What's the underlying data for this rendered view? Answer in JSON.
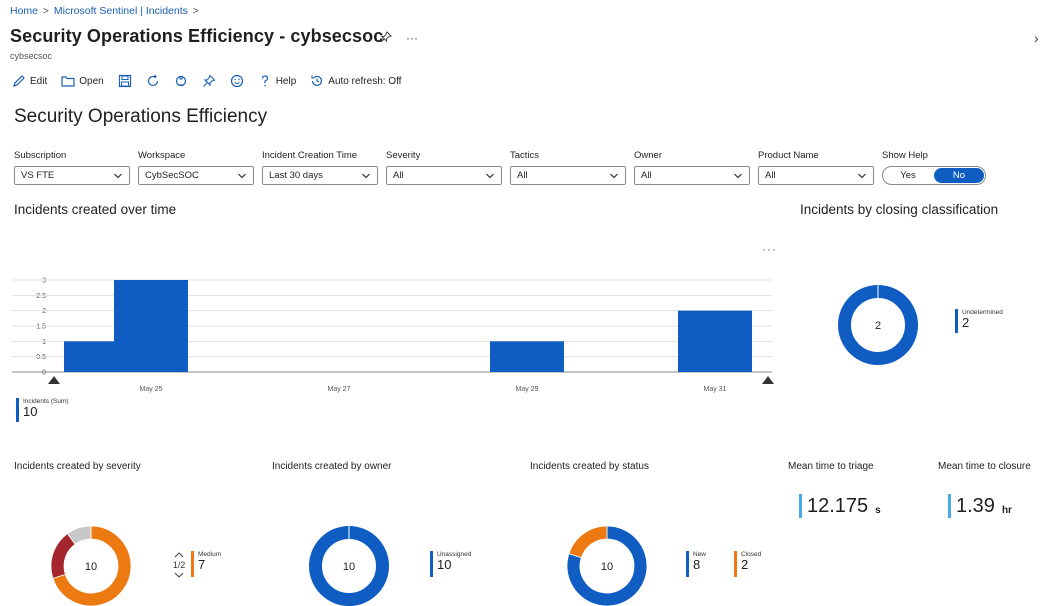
{
  "breadcrumb": {
    "items": [
      "Home",
      "Microsoft Sentinel | Incidents"
    ],
    "separator": ">"
  },
  "header": {
    "title": "Security Operations Efficiency - cybsecsoc",
    "subtitle": "cybsecsoc",
    "more": "···",
    "close": "›"
  },
  "toolbar": {
    "edit": "Edit",
    "open": "Open",
    "help": "Help",
    "auto_refresh": "Auto refresh: Off"
  },
  "workbook": {
    "title": "Security Operations Efficiency"
  },
  "filters": [
    {
      "label": "Subscription",
      "value": "VS FTE"
    },
    {
      "label": "Workspace",
      "value": "CybSecSOC"
    },
    {
      "label": "Incident Creation Time",
      "value": "Last 30 days"
    },
    {
      "label": "Severity",
      "value": "All"
    },
    {
      "label": "Tactics",
      "value": "All"
    },
    {
      "label": "Owner",
      "value": "All"
    },
    {
      "label": "Product Name",
      "value": "All"
    }
  ],
  "show_help": {
    "label": "Show Help",
    "yes": "Yes",
    "no": "No",
    "selected": "No"
  },
  "sections": {
    "over_time": "Incidents created over time",
    "closing": "Incidents by closing classification",
    "severity": "Incidents created by severity",
    "owner": "Incidents created by owner",
    "status": "Incidents created by status",
    "triage": "Mean time to triage",
    "closure": "Mean time to closure",
    "ellipsis": "···"
  },
  "colors": {
    "primary_blue": "#0f5cc2",
    "orange": "#ec7a10",
    "dark_red": "#a4262c",
    "gray": "#c8c8c8",
    "light_blue": "#4aa8e8"
  },
  "chart_data": [
    {
      "type": "bar",
      "ylim": [
        0,
        3
      ],
      "yticks": [
        "3",
        "2.5",
        "2",
        "1.5",
        "1",
        "0.5",
        "0"
      ],
      "xticks": [
        "May 25",
        "May 27",
        "May 29",
        "May 31"
      ],
      "x": [
        "May 24",
        "May 25",
        "May 29",
        "May 31"
      ],
      "values": [
        1,
        3,
        1,
        2
      ],
      "series": [
        {
          "name": "Incidents (Sum)",
          "total": "10"
        }
      ]
    },
    {
      "type": "pie",
      "center": "2",
      "slices": [
        {
          "label": "Undetermined",
          "value": 2,
          "display": "2"
        }
      ]
    },
    {
      "type": "pie",
      "center": "10",
      "pager": "1/2",
      "slices": [
        {
          "label": "Medium",
          "value": 7,
          "display": "7"
        },
        {
          "label": "",
          "value": 2
        },
        {
          "label": "",
          "value": 1
        }
      ]
    },
    {
      "type": "pie",
      "center": "10",
      "slices": [
        {
          "label": "Unassigned",
          "value": 10,
          "display": "10"
        }
      ]
    },
    {
      "type": "pie",
      "center": "10",
      "slices": [
        {
          "label": "New",
          "value": 8,
          "display": "8"
        },
        {
          "label": "Closed",
          "value": 2,
          "display": "2"
        }
      ]
    }
  ],
  "metrics": {
    "triage": {
      "value": "12.175",
      "unit": "s"
    },
    "closure": {
      "value": "1.39",
      "unit": "hr"
    }
  }
}
